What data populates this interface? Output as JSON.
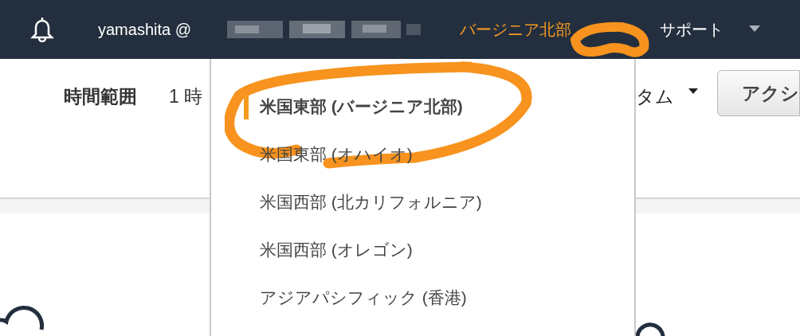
{
  "header": {
    "account_user": "yamashita @",
    "region": {
      "label": "バージニア北部",
      "expanded": true
    },
    "support": "サポート"
  },
  "toolbar": {
    "time_range_label": "時間範囲",
    "time_range_value": "1 時",
    "column_3": "タム",
    "action_button": "アクシ"
  },
  "region_menu": {
    "items": [
      {
        "label": "米国東部 (バージニア北部)",
        "selected": true
      },
      {
        "label": "米国東部 (オハイオ)",
        "selected": false
      },
      {
        "label": "米国西部 (北カリフォルニア)",
        "selected": false
      },
      {
        "label": "米国西部 (オレゴン)",
        "selected": false
      },
      {
        "label": "アジアパシフィック (香港)",
        "selected": false
      }
    ]
  }
}
